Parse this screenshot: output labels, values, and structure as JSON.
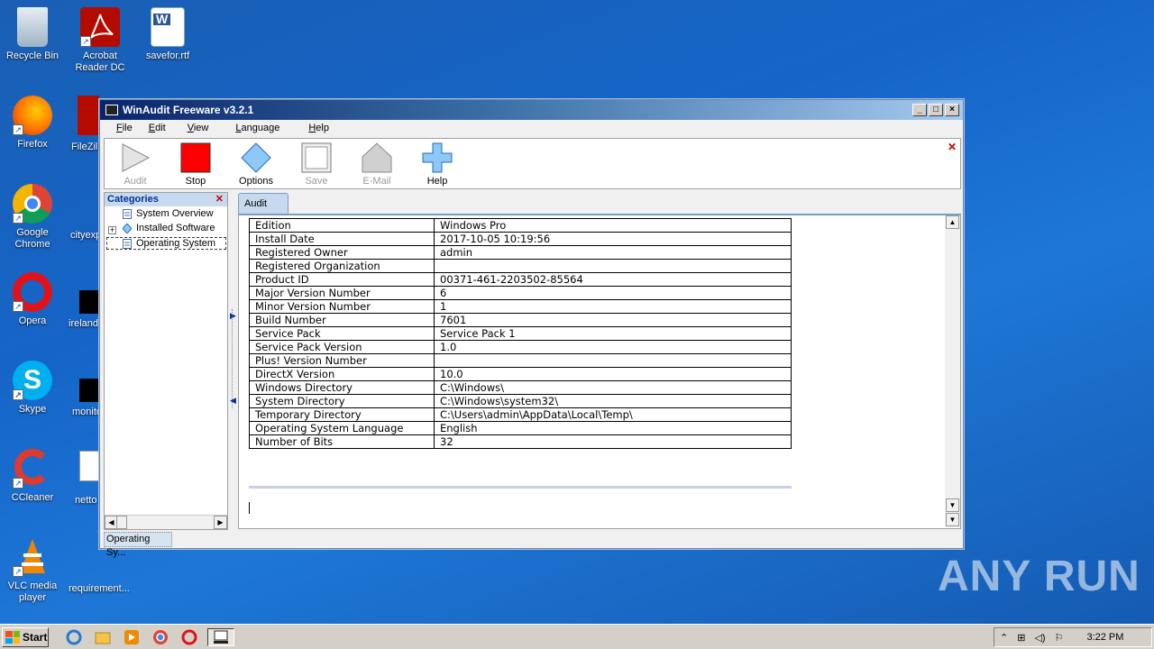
{
  "desktop": {
    "icons": [
      {
        "label": "Recycle Bin",
        "icon": "recycle-bin-icon"
      },
      {
        "label": "Acrobat Reader DC",
        "icon": "acrobat-icon"
      },
      {
        "label": "savefor.rtf",
        "icon": "word-doc-icon"
      },
      {
        "label": "Firefox",
        "icon": "firefox-icon"
      },
      {
        "label": "Google Chrome",
        "icon": "chrome-icon"
      },
      {
        "label": "Opera",
        "icon": "opera-icon"
      },
      {
        "label": "Skype",
        "icon": "skype-icon"
      },
      {
        "label": "CCleaner",
        "icon": "ccleaner-icon"
      },
      {
        "label": "VLC media player",
        "icon": "vlc-icon"
      }
    ],
    "partial_labels": [
      "FileZilla",
      "cityexp",
      "irelandr",
      "monito",
      "netto",
      "requirement..."
    ]
  },
  "window": {
    "title": "WinAudit Freeware v3.2.1",
    "controls": {
      "minimize": "_",
      "maximize": "□",
      "close": "×"
    },
    "menu": [
      "File",
      "Edit",
      "View",
      "Language",
      "Help"
    ],
    "toolbar": [
      {
        "label": "Audit",
        "icon": "play-icon",
        "enabled": false
      },
      {
        "label": "Stop",
        "icon": "stop-icon",
        "enabled": true
      },
      {
        "label": "Options",
        "icon": "diamond-icon",
        "enabled": true
      },
      {
        "label": "Save",
        "icon": "save-icon",
        "enabled": false
      },
      {
        "label": "E-Mail",
        "icon": "email-icon",
        "enabled": false
      },
      {
        "label": "Help",
        "icon": "plus-icon",
        "enabled": true
      }
    ],
    "categories": {
      "title": "Categories",
      "items": [
        {
          "label": "System Overview"
        },
        {
          "label": "Installed Software",
          "expander": "+"
        },
        {
          "label": "Operating System",
          "selected": true
        }
      ]
    },
    "tab": "Audit",
    "table": [
      [
        "Edition",
        "Windows Pro"
      ],
      [
        "Install Date",
        "2017-10-05 10:19:56"
      ],
      [
        "Registered Owner",
        "admin"
      ],
      [
        "Registered Organization",
        ""
      ],
      [
        "Product ID",
        "00371-461-2203502-85564"
      ],
      [
        "Major Version Number",
        "6"
      ],
      [
        "Minor Version Number",
        "1"
      ],
      [
        "Build Number",
        "7601"
      ],
      [
        "Service Pack",
        "Service Pack 1"
      ],
      [
        "Service Pack Version",
        "1.0"
      ],
      [
        "Plus! Version Number",
        ""
      ],
      [
        "DirectX Version",
        "10.0"
      ],
      [
        "Windows Directory",
        "C:\\Windows\\"
      ],
      [
        "System Directory",
        "C:\\Windows\\system32\\"
      ],
      [
        "Temporary Directory",
        "C:\\Users\\admin\\AppData\\Local\\Temp\\"
      ],
      [
        "Operating System Language",
        "English"
      ],
      [
        "Number of Bits",
        "32"
      ]
    ],
    "status": "Operating Sy..."
  },
  "taskbar": {
    "start": "Start",
    "tasks": [
      "ie-icon",
      "explorer-icon",
      "media-player-icon",
      "chrome-icon",
      "opera-icon",
      "winaudit-icon"
    ],
    "clock": "3:22 PM"
  },
  "watermark": "ANY RUN"
}
